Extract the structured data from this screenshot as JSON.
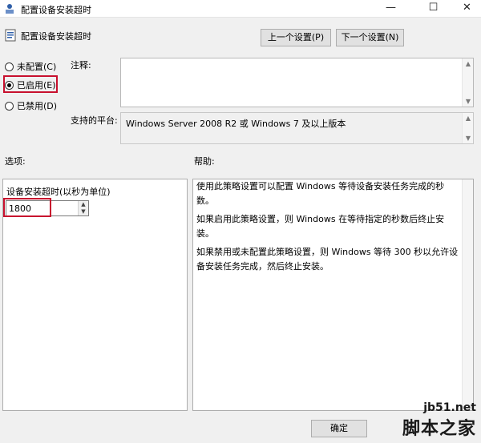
{
  "window": {
    "title": "配置设备安装超时",
    "controls": {
      "minimize": "—",
      "maximize": "☐",
      "close": "✕"
    }
  },
  "header": {
    "title": "配置设备安装超时"
  },
  "nav": {
    "prev_label": "上一个设置(P)",
    "next_label": "下一个设置(N)"
  },
  "state": {
    "options": [
      {
        "label": "未配置(C)",
        "selected": false
      },
      {
        "label": "已启用(E)",
        "selected": true
      },
      {
        "label": "已禁用(D)",
        "selected": false
      }
    ]
  },
  "comment": {
    "label": "注释:",
    "value": ""
  },
  "platform": {
    "label": "支持的平台:",
    "value": "Windows Server 2008 R2 或 Windows 7 及以上版本"
  },
  "options_section": {
    "heading": "选项:",
    "timeout_label": "设备安装超时(以秒为单位)",
    "timeout_value": "1800"
  },
  "help_section": {
    "heading": "帮助:",
    "paragraphs": [
      "使用此策略设置可以配置 Windows 等待设备安装任务完成的秒数。",
      "如果启用此策略设置，则 Windows 在等待指定的秒数后终止安装。",
      "如果禁用或未配置此策略设置，则 Windows 等待 300 秒以允许设备安装任务完成，然后终止安装。"
    ]
  },
  "footer": {
    "ok_label": "确定"
  },
  "watermark": {
    "site": "jb51.net",
    "name": "脚本之家"
  },
  "colors": {
    "highlight": "#c8102e"
  }
}
